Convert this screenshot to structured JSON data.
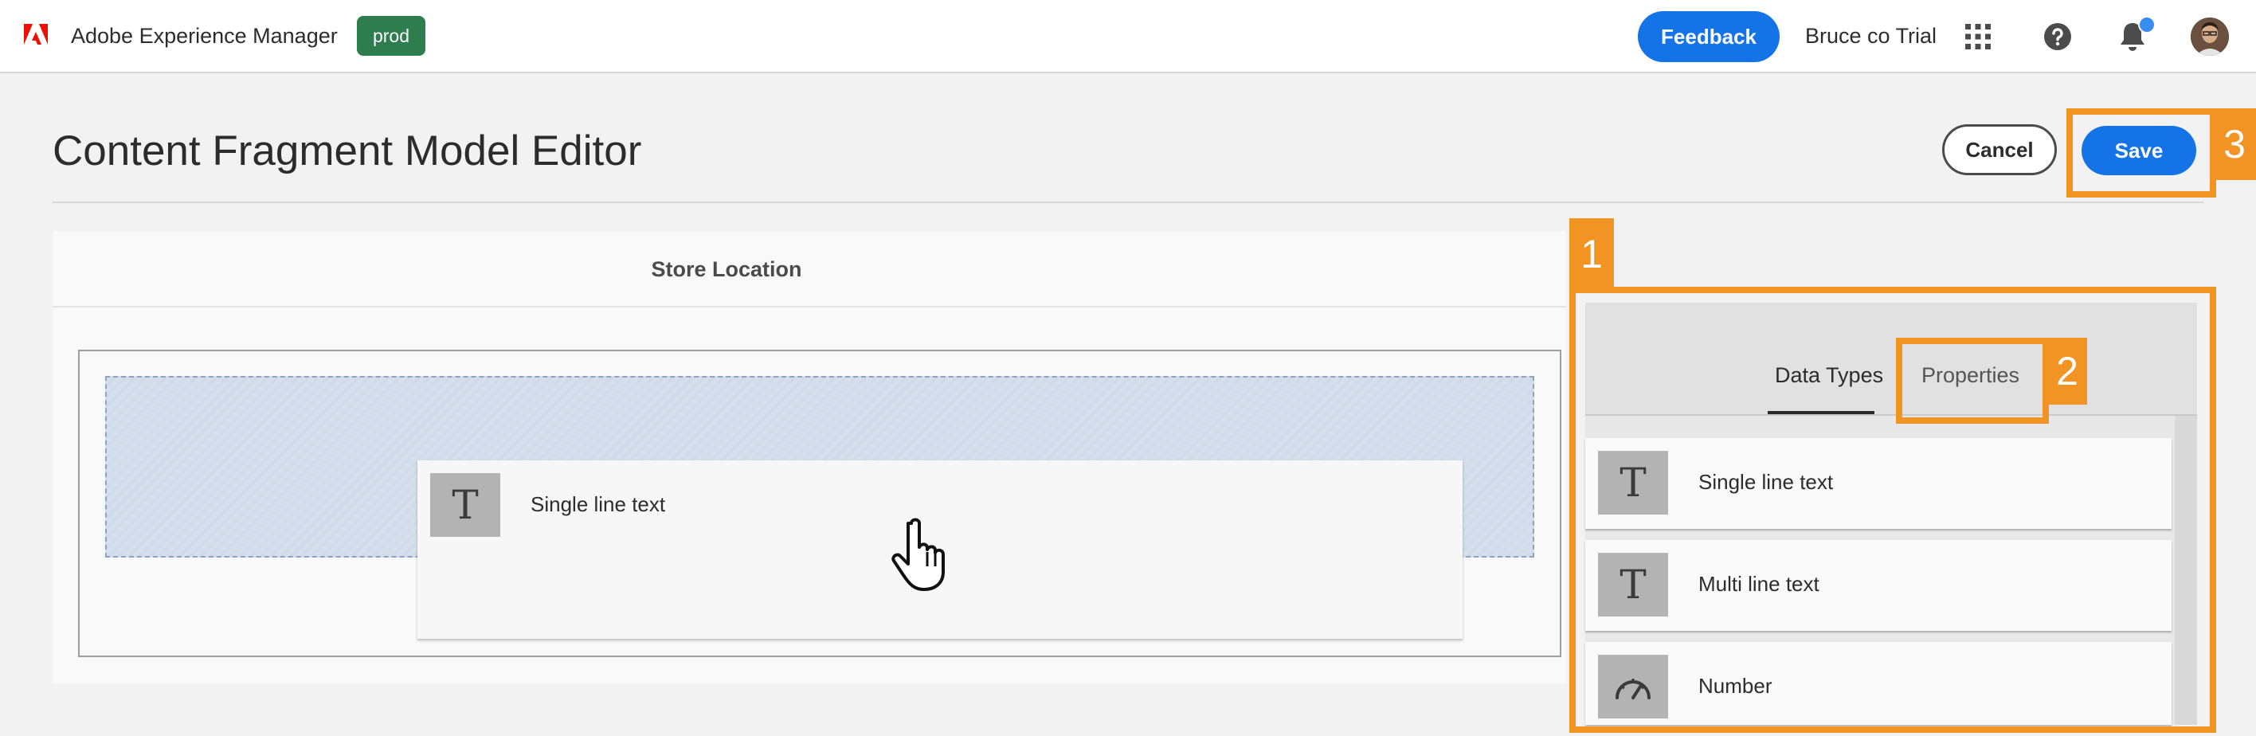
{
  "topbar": {
    "app_title": "Adobe Experience Manager",
    "env_badge": "prod",
    "feedback_label": "Feedback",
    "org_name": "Bruce co Trial",
    "icons": [
      "adobe-logo-icon",
      "apps-grid-icon",
      "help-icon",
      "bell-icon",
      "avatar"
    ],
    "colors": {
      "adobe_red": "#eb1000",
      "accent_blue": "#1473e6",
      "env_green": "#2d7d4f",
      "notification_dot": "#378ef0"
    }
  },
  "header": {
    "page_title": "Content Fragment Model Editor",
    "cancel_label": "Cancel",
    "save_label": "Save"
  },
  "canvas": {
    "model_name": "Store Location",
    "dragged_item": {
      "label": "Single line text",
      "icon": "text-t-icon"
    }
  },
  "panel": {
    "tabs": [
      {
        "label": "Data Types",
        "active": true
      },
      {
        "label": "Properties",
        "active": false
      }
    ],
    "data_types": [
      {
        "label": "Single line text",
        "icon": "text-t-icon"
      },
      {
        "label": "Multi line text",
        "icon": "text-t-icon"
      },
      {
        "label": "Number",
        "icon": "gauge-icon"
      }
    ]
  },
  "callouts": {
    "color": "#f29423",
    "labels": [
      "1",
      "2",
      "3"
    ]
  }
}
